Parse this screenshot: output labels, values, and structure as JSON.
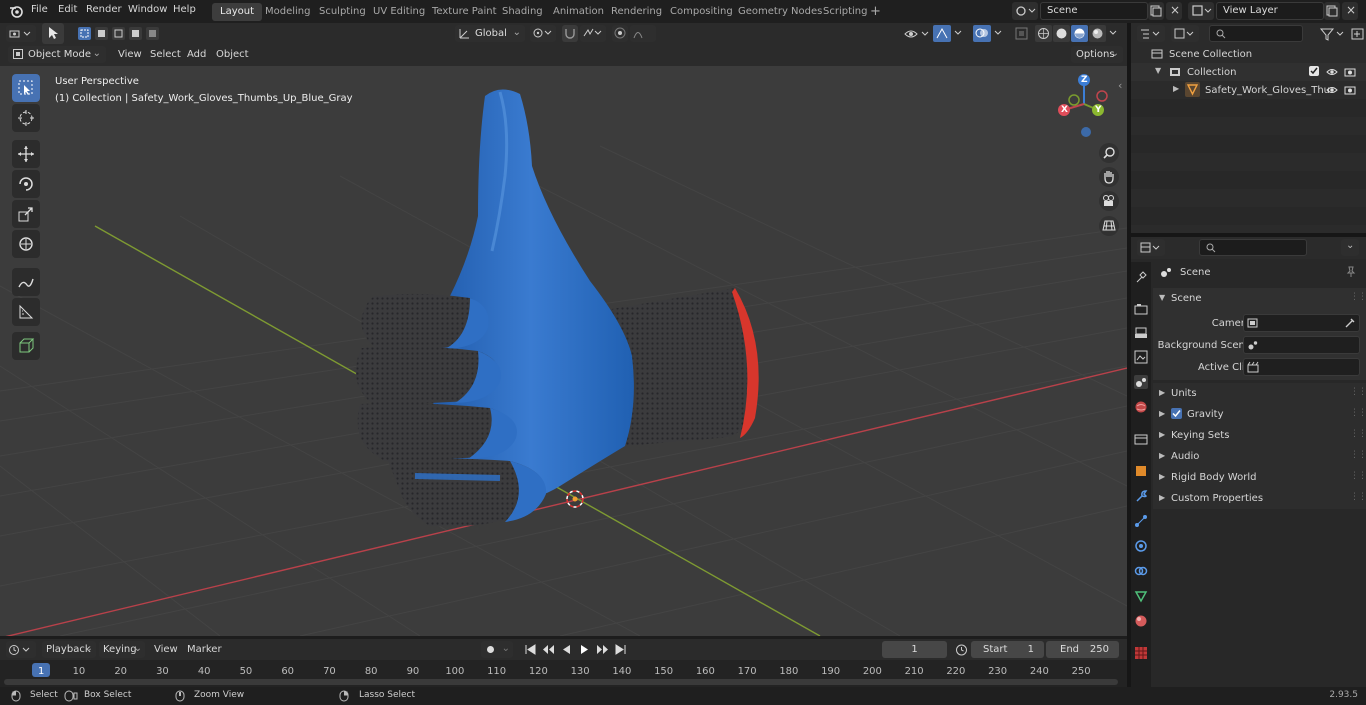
{
  "topbar": {
    "menus": [
      "File",
      "Edit",
      "Render",
      "Window",
      "Help"
    ],
    "workspaces": [
      "Layout",
      "Modeling",
      "Sculpting",
      "UV Editing",
      "Texture Paint",
      "Shading",
      "Animation",
      "Rendering",
      "Compositing",
      "Geometry Nodes",
      "Scripting"
    ],
    "active_workspace": "Layout",
    "scene_name": "Scene",
    "view_layer": "View Layer"
  },
  "viewport_header": {
    "mode": "Object Mode",
    "menus": [
      "View",
      "Select",
      "Add",
      "Object"
    ],
    "transform_orientation": "Global",
    "options_label": "Options"
  },
  "viewport": {
    "perspective_label": "User Perspective",
    "collection_label": "(1) Collection | Safety_Work_Gloves_Thumbs_Up_Blue_Gray",
    "gizmo_axes": [
      "X",
      "Y",
      "Z"
    ],
    "colors": {
      "x_axis": "#c0454d",
      "y_axis": "#7a9c2e",
      "z_axis": "#3c7ed6",
      "glove_blue": "#2f6fc4",
      "knit_gray": "#3a3a3c",
      "cuff_red": "#d8362c"
    }
  },
  "toolbar": {
    "tools": [
      "select-box-icon",
      "cursor-icon",
      "move-icon",
      "rotate-icon",
      "scale-icon",
      "transform-icon",
      "annotate-icon",
      "measure-icon",
      "add-cube-icon"
    ]
  },
  "outliner": {
    "root": "Scene Collection",
    "collection": "Collection",
    "object": "Safety_Work_Gloves_Thu"
  },
  "properties": {
    "context": "Scene",
    "section": "Scene",
    "fields": [
      {
        "label": "Camera",
        "value": ""
      },
      {
        "label": "Background Scene",
        "value": ""
      },
      {
        "label": "Active Clip",
        "value": ""
      }
    ],
    "panels": [
      "Units",
      "Gravity",
      "Keying Sets",
      "Audio",
      "Rigid Body World",
      "Custom Properties"
    ],
    "gravity_checked": true
  },
  "timeline": {
    "menus": [
      "Playback",
      "Keying",
      "View",
      "Marker"
    ],
    "current_frame": "1",
    "start_label": "Start",
    "start_value": "1",
    "end_label": "End",
    "end_value": "250",
    "ticks": [
      "1",
      "10",
      "20",
      "30",
      "40",
      "50",
      "60",
      "70",
      "80",
      "90",
      "100",
      "110",
      "120",
      "130",
      "140",
      "150",
      "160",
      "170",
      "180",
      "190",
      "200",
      "210",
      "220",
      "230",
      "240",
      "250"
    ]
  },
  "statusbar": {
    "items": [
      "Select",
      "Box Select",
      "Zoom View",
      "Lasso Select"
    ],
    "version": "2.93.5"
  }
}
